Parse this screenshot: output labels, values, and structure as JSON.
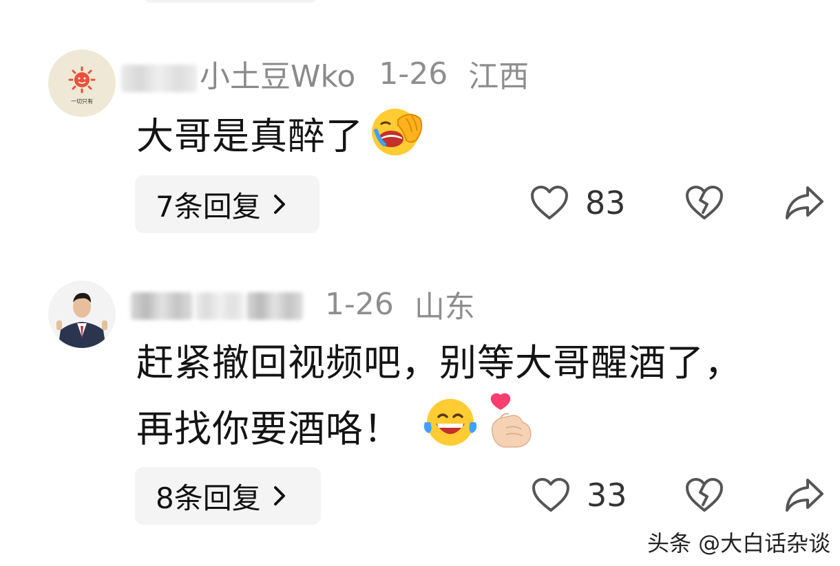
{
  "comments": [
    {
      "username_visible": "小土豆Wko",
      "date": "1-26",
      "region": "江西",
      "avatar_caption": "一切只有",
      "text_line1": "大哥是真醉了",
      "reply_label": "7条回复",
      "likes": "83"
    },
    {
      "date": "1-26",
      "region": "山东",
      "text_line1": "赶紧撤回视频吧，别等大哥醒酒了，",
      "text_line2": "再找你要酒咯！",
      "reply_label": "8条回复",
      "likes": "33"
    }
  ],
  "watermark": "头条 @大白话杂谈",
  "icons": {
    "like": "heart-outline-icon",
    "dislike": "broken-heart-icon",
    "share": "share-arrow-icon",
    "reply_chevron": "chevron-right-icon"
  },
  "colors": {
    "meta_gray": "#8e8e8e",
    "button_bg": "#f4f4f4",
    "text": "#141414",
    "icon_gray": "#555555"
  }
}
